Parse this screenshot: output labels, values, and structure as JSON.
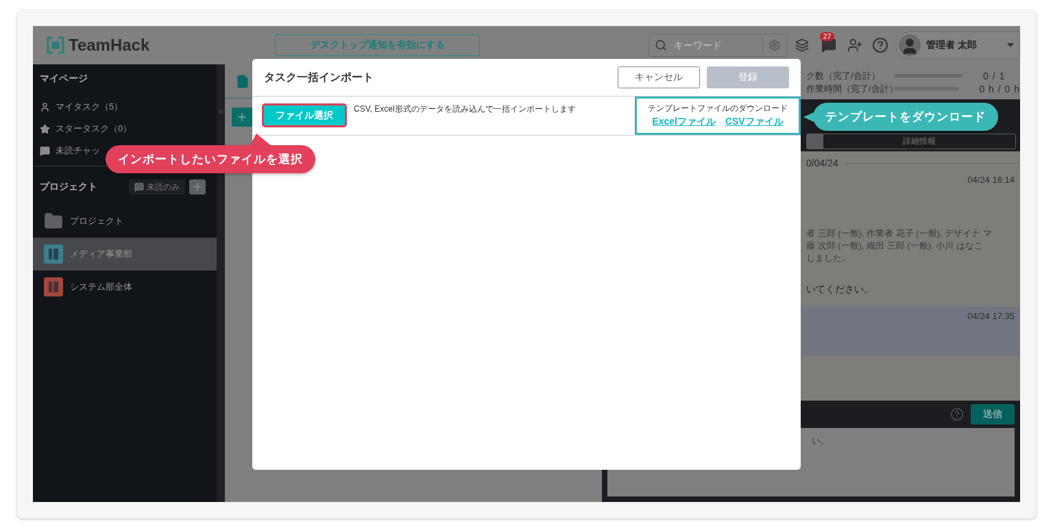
{
  "header": {
    "logo": "TeamHack",
    "notify_button": "デスクトップ通知を有効にする",
    "search": {
      "placeholder": "キーワード"
    },
    "notification_count": "27",
    "user_name": "管理者 太郎"
  },
  "sidebar": {
    "mypage_title": "マイページ",
    "mypage_items": [
      {
        "label": "マイタスク（5）",
        "kind": "person"
      },
      {
        "label": "スタータスク（0）",
        "kind": "star"
      },
      {
        "label": "未読チャッ",
        "kind": "chat"
      }
    ],
    "project_title": "プロジェクト",
    "unread_filter": "未読のみ",
    "projects": [
      {
        "label": "プロジェクト",
        "kind": "folder",
        "selected": false
      },
      {
        "label": "メディア事業部",
        "kind": "board",
        "color": "#3d7f8c",
        "selected": true
      },
      {
        "label": "システム部全体",
        "kind": "board",
        "color": "#a2483c",
        "selected": false
      }
    ]
  },
  "right_panel": {
    "summary": [
      {
        "label": "ク数（完了/合計）",
        "level": 0,
        "reading": "0 / 1"
      },
      {
        "label": "作業時間（完了/合計）",
        "level": 0,
        "reading": "0 h / 0 h"
      }
    ],
    "tab": "詳細情報",
    "date": "0/04/24",
    "messages": [
      {
        "time": "04/24 16:14",
        "highlighted": false,
        "lines": [
          "者 三郎 (一般), 作業者 花子 (一般), デザイナ マ",
          "藤 次郎 (一般), 織田 三郎 (一般), 小川 はなこ",
          "しました。"
        ],
        "tail": "いてください。"
      },
      {
        "time": "04/24 17:35",
        "highlighted": true
      }
    ],
    "send_button": "送信",
    "composer_placeholder": "い。"
  },
  "modal": {
    "title": "タスク一括インポート",
    "buttons": [
      {
        "label": "キャンセル",
        "disabled": false
      },
      {
        "label": "登録",
        "disabled": true
      }
    ],
    "file_button": "ファイル選択",
    "description": "CSV, Excel形式のデータを読み込んで一括インポートします",
    "template_title": "テンプレートファイルのダウンロード",
    "template_links": [
      "Excelファイル",
      "CSVファイル"
    ]
  },
  "callouts": [
    {
      "text": "インポートしたいファイルを選択",
      "kind": "red"
    },
    {
      "text": "テンプレートをダウンロード",
      "kind": "teal"
    }
  ]
}
